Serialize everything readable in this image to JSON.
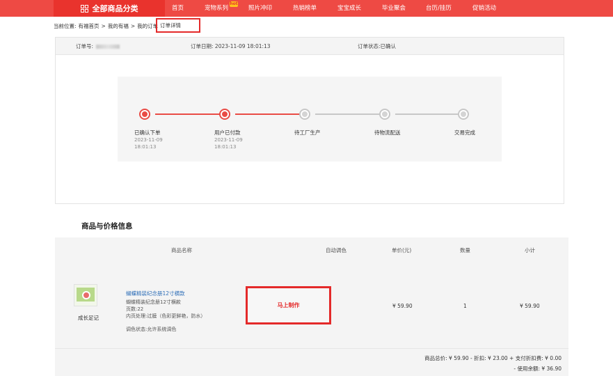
{
  "nav": {
    "all_categories": "全部商品分类",
    "items": [
      "首页",
      "宠物系列",
      "照片冲印",
      "热销榜单",
      "宝宝成长",
      "毕业聚会",
      "台历/挂历",
      "促销活动"
    ],
    "hot_badge": "hot"
  },
  "breadcrumb": {
    "prefix": "当前位置:",
    "items": [
      "有福首页",
      "我的有福",
      "我的订单"
    ],
    "separator": ">",
    "current": "订单详情"
  },
  "order": {
    "number_label": "订单号:",
    "date_label": "订单日期:",
    "date_value": "2023-11-09 18:01:13",
    "status_label": "订单状态:",
    "status_value": "已确认",
    "steps": [
      {
        "label": "已确认下单",
        "date": "2023-11-09",
        "time": "18:01:13",
        "done": true
      },
      {
        "label": "用户已付款",
        "date": "2023-11-09",
        "time": "18:01:13",
        "done": true
      },
      {
        "label": "待工厂生产",
        "date": "",
        "time": "",
        "done": false
      },
      {
        "label": "待物流配送",
        "date": "",
        "time": "",
        "done": false
      },
      {
        "label": "交易完成",
        "date": "",
        "time": "",
        "done": false
      }
    ]
  },
  "goods": {
    "section_title": "商品与价格信息",
    "headers": {
      "name": "商品名称",
      "auto_color": "自动调色",
      "unit_price": "单价(元)",
      "qty": "数量",
      "subtotal": "小计"
    },
    "item": {
      "thumb_caption": "成长足记",
      "title": "蝴蝶精装纪念册12寸横款",
      "spec": "蝴蝶精装纪念册12寸横款",
      "pages": "页数:22",
      "inner_process": "内页处理:过膜（色彩更鲜艳，防水）",
      "color_status": "调色状态:允许系统调色",
      "make_button": "马上制作",
      "unit_price": "¥ 59.90",
      "qty": "1",
      "subtotal": "¥ 59.90"
    },
    "summary": {
      "line1": "商品总价:  ¥ 59.90  -  折扣:  ¥ 23.00  +  支付折扣费:  ¥ 0.00",
      "line2": "-  使用余额:  ¥ 36.90"
    }
  }
}
